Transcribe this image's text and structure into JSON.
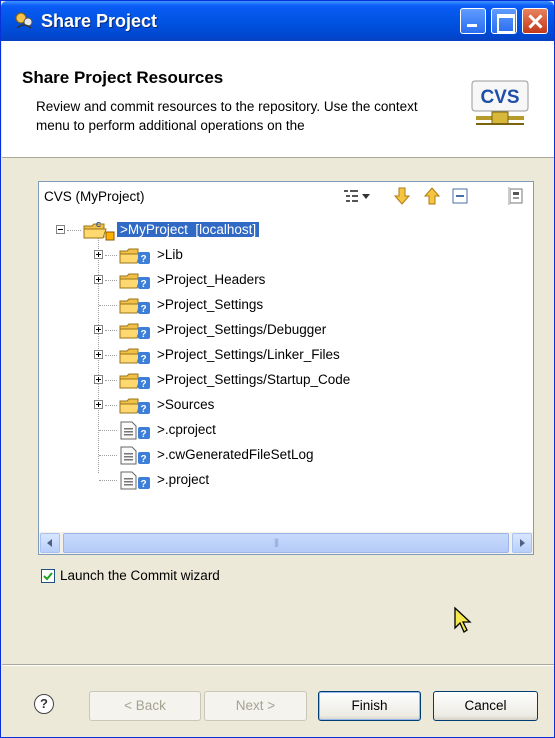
{
  "window": {
    "title": "Share Project",
    "icons": {
      "app": "cvs-share-icon",
      "minimize": "minimize-icon",
      "maximize": "maximize-icon",
      "close": "close-icon"
    }
  },
  "header": {
    "title": "Share Project Resources",
    "description": "Review and commit resources to the repository. Use the context menu to perform additional operations on the",
    "logo_text": "CVS"
  },
  "panel": {
    "title": "CVS (MyProject)",
    "toolbar_icons": [
      "layout-icon",
      "dropdown-icon",
      "next-change-icon",
      "previous-change-icon",
      "collapse-all-icon",
      "pin-icon"
    ]
  },
  "tree": {
    "root": {
      "label": ">MyProject  [localhost]",
      "expanded": true,
      "selected": true
    },
    "items": [
      {
        "label": ">Lib",
        "type": "folder",
        "expandable": true
      },
      {
        "label": ">Project_Headers",
        "type": "folder",
        "expandable": true
      },
      {
        "label": ">Project_Settings",
        "type": "folder",
        "expandable": false
      },
      {
        "label": ">Project_Settings/Debugger",
        "type": "folder",
        "expandable": true
      },
      {
        "label": ">Project_Settings/Linker_Files",
        "type": "folder",
        "expandable": true
      },
      {
        "label": ">Project_Settings/Startup_Code",
        "type": "folder",
        "expandable": true
      },
      {
        "label": ">Sources",
        "type": "folder",
        "expandable": true
      },
      {
        "label": ">.cproject",
        "type": "file",
        "expandable": false
      },
      {
        "label": ">.cwGeneratedFileSetLog",
        "type": "file",
        "expandable": false
      },
      {
        "label": ">.project",
        "type": "file",
        "expandable": false
      }
    ]
  },
  "options": {
    "launch_commit_label": "Launch the Commit wizard",
    "launch_commit_checked": true
  },
  "buttons": {
    "help": "?",
    "back": "< Back",
    "next": "Next >",
    "finish": "Finish",
    "cancel": "Cancel"
  },
  "colors": {
    "titlebar": "#0054e3",
    "selection": "#316ac5",
    "dialog_bg": "#ece9d8"
  }
}
